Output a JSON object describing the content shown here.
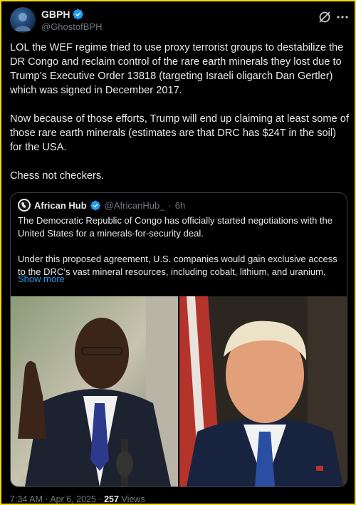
{
  "author": {
    "display_name": "GBPH",
    "handle": "@GhostofBPH",
    "avatar_icon": "avatar-portrait-icon",
    "verified_icon": "verified-badge-icon"
  },
  "tweet": {
    "text": "LOL the WEF regime tried to use proxy terrorist groups to destabilize the DR Congo and reclaim control of the rare earth minerals they lost due to Trump’s Executive Order 13818 (targeting Israeli oligarch Dan Gertler) which was signed in December 2017.\n\nNow because of those efforts, Trump will end up claiming at least some of those rare earth minerals (estimates are that DRC has $24T in the soil) for the USA.\n\nChess not checkers."
  },
  "quote": {
    "display_name": "African Hub",
    "handle": "@AfricanHub_",
    "separator": "·",
    "time": "6h",
    "text": "The Democratic Republic of Congo has officially started negotiations with the United States for a minerals-for-security deal.\n\nUnder this proposed agreement, U.S. companies would gain exclusive access to the DRC’s vast mineral resources, including cobalt, lithium, and uranium,",
    "show_more": "Show more"
  },
  "meta": {
    "time": "7:34 AM",
    "separator1": "·",
    "date": "Apr 6, 2025",
    "separator2": "·",
    "views_count": "257",
    "views_label": "Views"
  },
  "colors": {
    "accent": "#1d9bf0",
    "border_highlight": "#f5d90a",
    "secondary_text": "#71767b"
  }
}
